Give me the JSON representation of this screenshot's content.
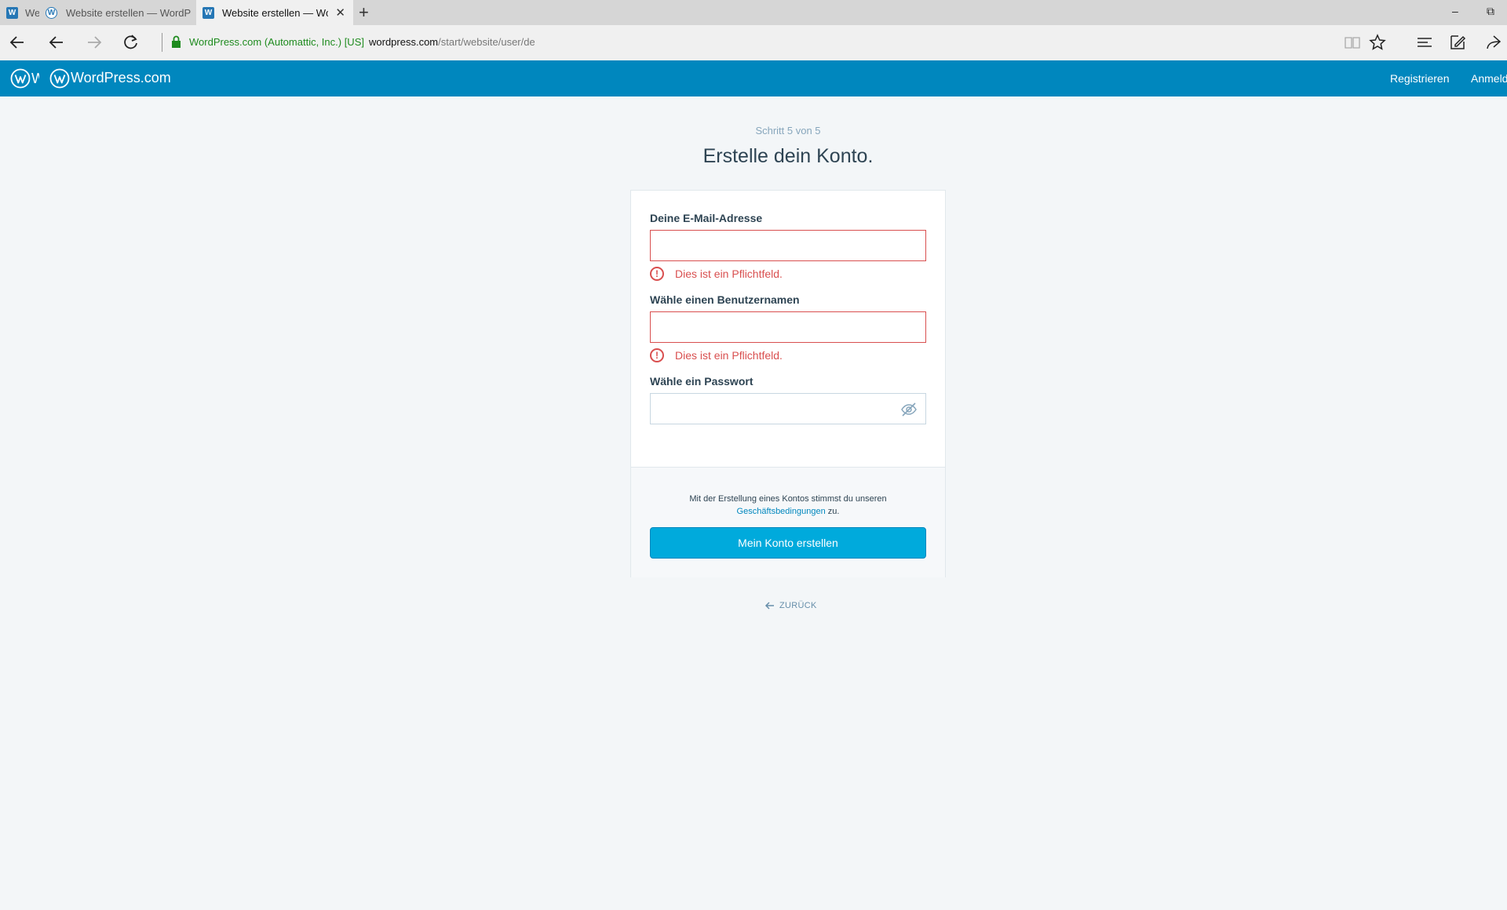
{
  "browser": {
    "tabs": [
      {
        "title": "We",
        "favicon": "wordpress-square-icon",
        "active": false
      },
      {
        "title": "Website erstellen — WordP",
        "favicon": "wordpress-round-icon",
        "active": false
      },
      {
        "title": "Website erstellen — Wc",
        "favicon": "wordpress-square-icon",
        "active": true
      }
    ],
    "new_tab_glyph": "+",
    "minimize_glyph": "–",
    "restore_glyph": "⧉",
    "close_tab_glyph": "✕",
    "cert_label": "WordPress.com (Automattic, Inc.) [US]",
    "url_host": "wordpress.com",
    "url_path": "/start/website/user/de"
  },
  "masterbar": {
    "logo_text": "W",
    "brand": "WordPress.com",
    "signup_link": "Registrieren",
    "login_link": "Anmeldung",
    "color": "#0087be"
  },
  "signup": {
    "step": "Schritt 5 von 5",
    "heading": "Erstelle dein Konto.",
    "email": {
      "label": "Deine E-Mail-Adresse",
      "value": "",
      "error": "Dies ist ein Pflichtfeld."
    },
    "username": {
      "label": "Wähle einen Benutzernamen",
      "value": "",
      "error": "Dies ist ein Pflichtfeld."
    },
    "password": {
      "label": "Wähle ein Passwort",
      "value": ""
    },
    "error_glyph": "!",
    "terms_prefix": "Mit der Erstellung eines Kontos stimmst du unseren",
    "terms_link": "Geschäftsbedingungen",
    "terms_suffix": " zu.",
    "submit_label": "Mein Konto erstellen",
    "back_label": "ZURÜCK",
    "error_color": "#d94f4f",
    "button_color": "#00aadc"
  }
}
